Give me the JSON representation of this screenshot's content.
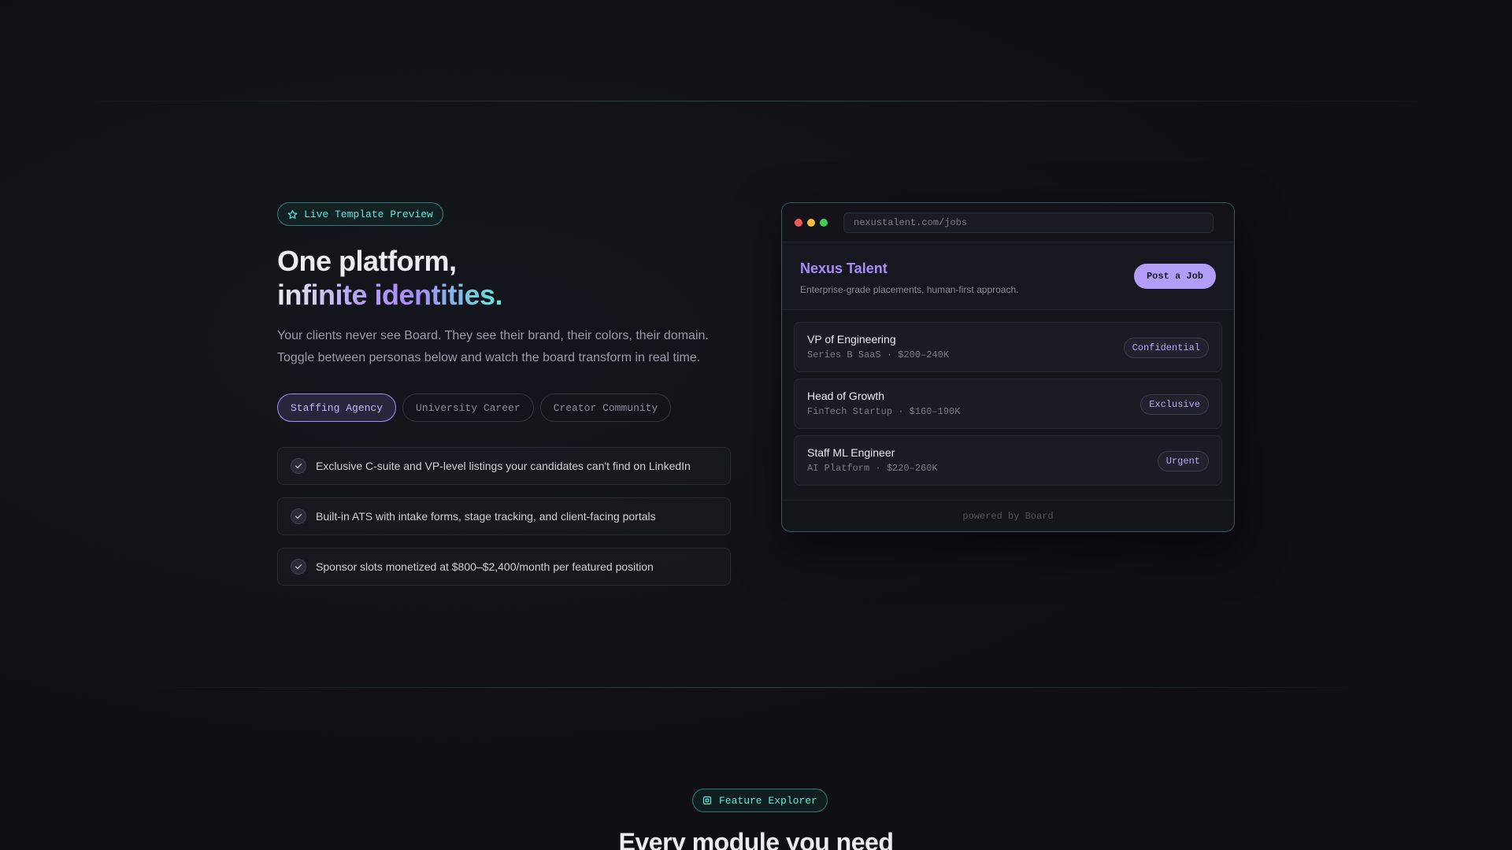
{
  "hero": {
    "badge": "Live Template Preview",
    "headline_line1": "One platform,",
    "headline_line2": "infinite identities.",
    "subtext": "Your clients never see Board. They see their brand, their colors, their domain. Toggle between personas below and watch the board transform in real time.",
    "personas": [
      {
        "label": "Staffing Agency",
        "active": true
      },
      {
        "label": "University Career",
        "active": false
      },
      {
        "label": "Creator Community",
        "active": false
      }
    ],
    "features": [
      "Exclusive C-suite and VP-level listings your candidates can't find on LinkedIn",
      "Built-in ATS with intake forms, stage tracking, and client-facing portals",
      "Sponsor slots monetized at $800–$2,400/month per featured position"
    ]
  },
  "preview": {
    "url": "nexustalent.com/jobs",
    "brand": "Nexus Talent",
    "tagline": "Enterprise-grade placements, human-first approach.",
    "post_button": "Post a Job",
    "jobs": [
      {
        "title": "VP of Engineering",
        "meta": "Series B SaaS · $200–240K",
        "tag": "Confidential"
      },
      {
        "title": "Head of Growth",
        "meta": "FinTech Startup · $160–190K",
        "tag": "Exclusive"
      },
      {
        "title": "Staff ML Engineer",
        "meta": "AI Platform · $220–260K",
        "tag": "Urgent"
      }
    ],
    "footer": "powered by Board"
  },
  "explorer": {
    "badge": "Feature Explorer",
    "title": "Every module you need"
  },
  "colors": {
    "accent_teal": "#5eead4",
    "accent_purple": "#a78bfa",
    "background": "#0f0f14"
  },
  "icons": {
    "hero_badge": "star-icon",
    "feature_check": "check-icon",
    "explorer_badge": "grid-icon"
  }
}
